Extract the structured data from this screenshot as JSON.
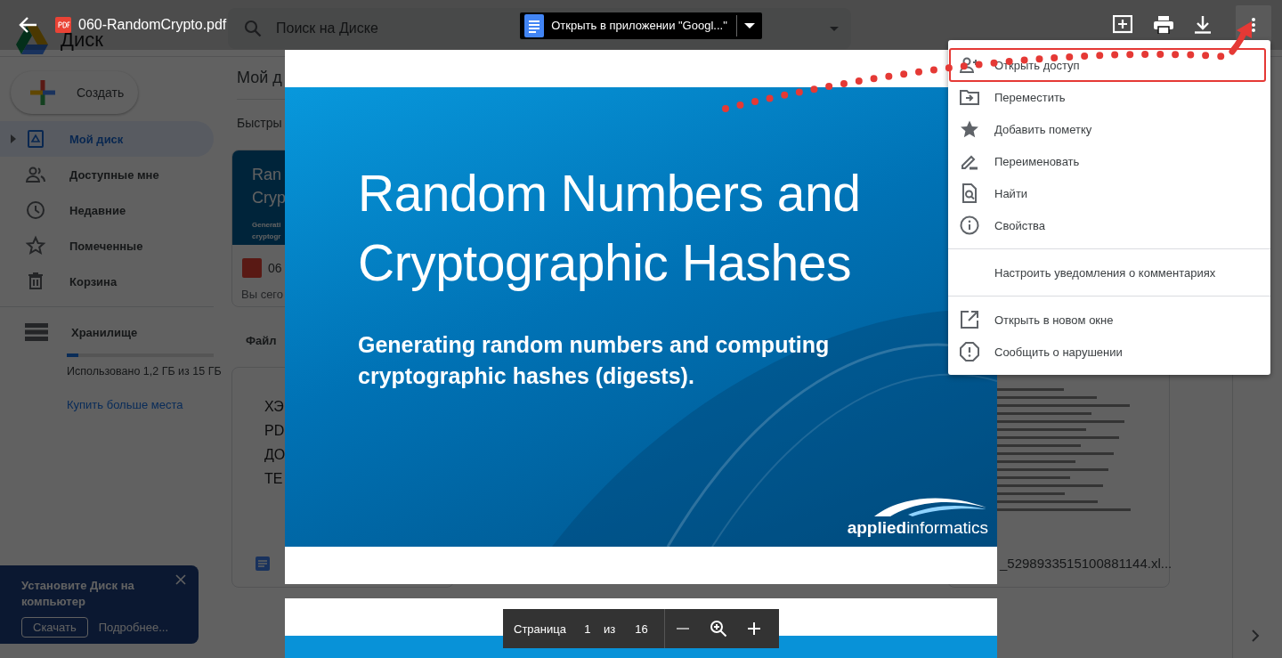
{
  "drive": {
    "logo": "Диск",
    "search_placeholder": "Поиск на Диске",
    "create": "Создать",
    "nav": [
      {
        "kind": "my-drive",
        "label": "Мой диск",
        "selected": true
      },
      {
        "kind": "shared",
        "label": "Доступные мне",
        "selected": false
      },
      {
        "kind": "recent",
        "label": "Недавние",
        "selected": false
      },
      {
        "kind": "starred",
        "label": "Помеченные",
        "selected": false
      },
      {
        "kind": "trash",
        "label": "Корзина",
        "selected": false
      }
    ],
    "storage": {
      "label": "Хранилище",
      "level": 0.08,
      "usage": "Использовано 1,2 ГБ из 15 ГБ",
      "buy": "Купить больше места"
    },
    "heading": "Мой д",
    "quick_access": "Быстры",
    "quick_card": {
      "thumb_title": [
        "Ran",
        "Cryp"
      ],
      "thumb_subtitle": [
        "Generati",
        "cryptogr"
      ],
      "name": "06",
      "note": "Вы сего"
    },
    "files_label": "Файл",
    "file_cards": [
      {
        "kind": "doc",
        "preview": [
          "ХЭ",
          "PD",
          "ДО",
          "ТЕ"
        ]
      },
      {
        "kind": "sheet",
        "name": "_5298933515100881144.xl..."
      }
    ],
    "banner": {
      "title": "Установите Диск на компьютер",
      "download": "Скачать",
      "more": "Подробнее..."
    }
  },
  "viewer": {
    "file_name": "060-RandomCrypto.pdf",
    "open_with": "Открыть в приложении \"Googl...\""
  },
  "pdf": {
    "title": "Random Numbers and Cryptographic Hashes",
    "subtitle": "Generating random numbers and computing cryptographic hashes (digests).",
    "brand": [
      "applied",
      "informatics"
    ]
  },
  "page_controls": {
    "label": "Страница",
    "page": "1",
    "of": "из",
    "total": "16"
  },
  "menu": {
    "sections": [
      [
        {
          "kind": "share",
          "label": "Открыть доступ",
          "highlighted": true
        },
        {
          "kind": "move",
          "label": "Переместить",
          "highlighted": false
        },
        {
          "kind": "star",
          "label": "Добавить пометку",
          "highlighted": false
        },
        {
          "kind": "rename",
          "label": "Переименовать",
          "highlighted": false
        },
        {
          "kind": "find",
          "label": "Найти",
          "highlighted": false
        },
        {
          "kind": "info",
          "label": "Свойства",
          "highlighted": false
        }
      ],
      [
        {
          "kind": "none",
          "label": "Настроить уведомления о комментариях",
          "highlighted": false
        }
      ],
      [
        {
          "kind": "open-window",
          "label": "Открыть в новом окне",
          "highlighted": false
        },
        {
          "kind": "report",
          "label": "Сообщить о нарушении",
          "highlighted": false
        }
      ]
    ]
  }
}
